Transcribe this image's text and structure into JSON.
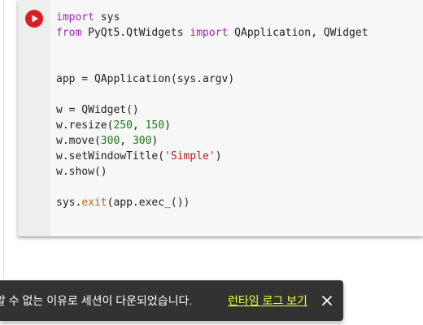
{
  "code_cell": {
    "run_icon": "play-circle-icon",
    "lines": [
      [
        {
          "t": "import",
          "c": "kw"
        },
        {
          "t": " sys",
          "c": ""
        }
      ],
      [
        {
          "t": "from",
          "c": "kw"
        },
        {
          "t": " PyQt5.QtWidgets ",
          "c": ""
        },
        {
          "t": "import",
          "c": "kw"
        },
        {
          "t": " QApplication, QWidget",
          "c": ""
        }
      ],
      [],
      [],
      [
        {
          "t": "app = QApplication(sys.argv)",
          "c": ""
        }
      ],
      [],
      [
        {
          "t": "w = QWidget()",
          "c": ""
        }
      ],
      [
        {
          "t": "w.resize(",
          "c": ""
        },
        {
          "t": "250",
          "c": "num"
        },
        {
          "t": ", ",
          "c": ""
        },
        {
          "t": "150",
          "c": "num"
        },
        {
          "t": ")",
          "c": ""
        }
      ],
      [
        {
          "t": "w.move(",
          "c": ""
        },
        {
          "t": "300",
          "c": "num"
        },
        {
          "t": ", ",
          "c": ""
        },
        {
          "t": "300",
          "c": "num"
        },
        {
          "t": ")",
          "c": ""
        }
      ],
      [
        {
          "t": "w.setWindowTitle(",
          "c": ""
        },
        {
          "t": "'Simple'",
          "c": "str"
        },
        {
          "t": ")",
          "c": ""
        }
      ],
      [
        {
          "t": "w.show()",
          "c": ""
        }
      ],
      [],
      [
        {
          "t": "sys.",
          "c": ""
        },
        {
          "t": "exit",
          "c": "fn"
        },
        {
          "t": "(app.exec_())",
          "c": ""
        }
      ]
    ]
  },
  "snackbar": {
    "message": "알 수 없는 이유로 세션이 다운되었습니다.",
    "action_label": "런타임 로그 보기",
    "close_icon": "close-icon"
  },
  "colors": {
    "run_button": "#d81f26",
    "snackbar_bg": "#323232",
    "action_text": "#eeff41",
    "keyword": "#9c27b0",
    "number": "#1b7a1b",
    "string": "#b71c1c",
    "builtin": "#b5651d"
  }
}
